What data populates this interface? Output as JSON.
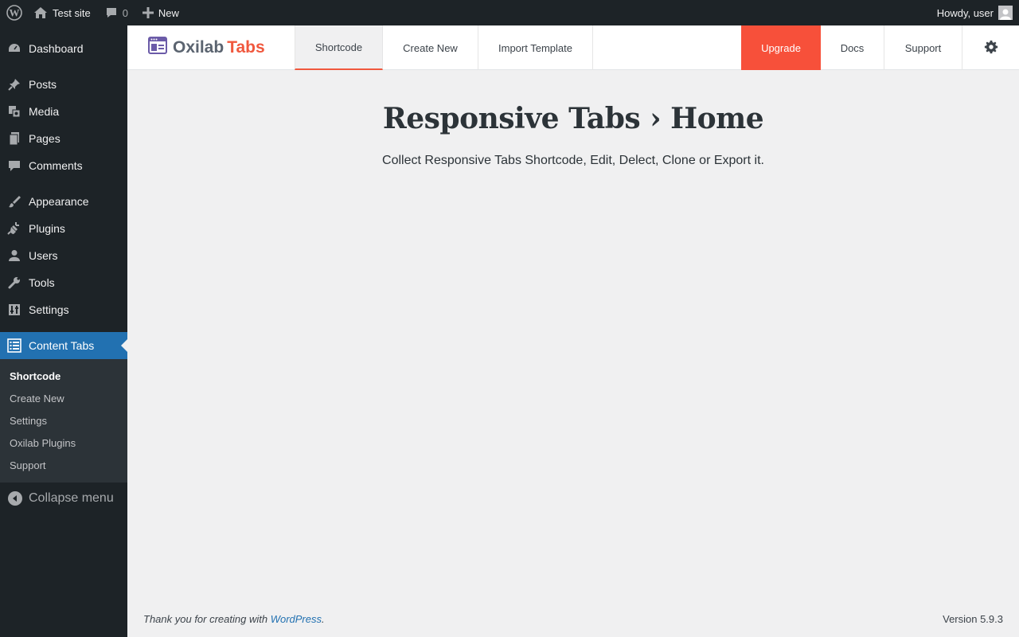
{
  "adminbar": {
    "site_name": "Test site",
    "comments_count": "0",
    "new_label": "New",
    "howdy": "Howdy, user"
  },
  "sidebar": {
    "items": [
      {
        "label": "Dashboard",
        "icon": "dashboard-icon"
      },
      {
        "label": "Posts",
        "icon": "pushpin-icon"
      },
      {
        "label": "Media",
        "icon": "media-icon"
      },
      {
        "label": "Pages",
        "icon": "pages-icon"
      },
      {
        "label": "Comments",
        "icon": "comment-icon"
      },
      {
        "label": "Appearance",
        "icon": "brush-icon"
      },
      {
        "label": "Plugins",
        "icon": "plug-icon"
      },
      {
        "label": "Users",
        "icon": "user-icon"
      },
      {
        "label": "Tools",
        "icon": "wrench-icon"
      },
      {
        "label": "Settings",
        "icon": "settings-sliders-icon"
      },
      {
        "label": "Content Tabs",
        "icon": "list-icon"
      }
    ],
    "submenu": [
      "Shortcode",
      "Create New",
      "Settings",
      "Oxilab Plugins",
      "Support"
    ],
    "collapse_label": "Collapse menu"
  },
  "plugin": {
    "logo_part1": "Oxilab",
    "logo_part2": "Tabs",
    "tabs": [
      "Shortcode",
      "Create New",
      "Import Template"
    ],
    "right_tabs": [
      "Upgrade",
      "Docs",
      "Support"
    ],
    "accent_color": "#f7503a"
  },
  "main": {
    "title": "Responsive Tabs › Home",
    "subtitle": "Collect Responsive Tabs Shortcode, Edit, Delect, Clone or Export it."
  },
  "footer": {
    "thanks": "Thank you for creating with",
    "link": "WordPress",
    "version": "Version 5.9.3"
  }
}
